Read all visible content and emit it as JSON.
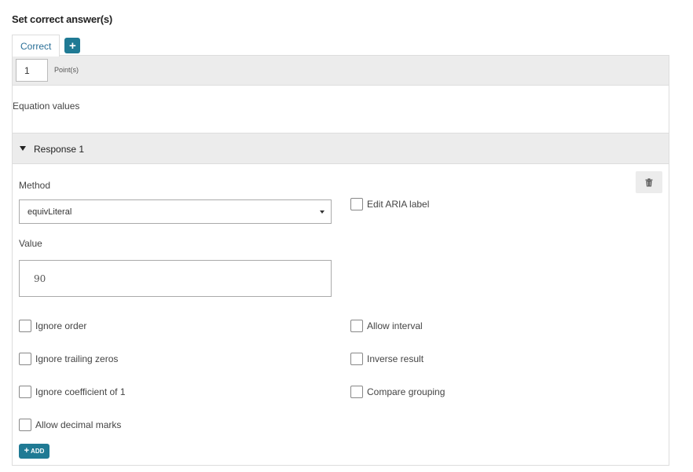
{
  "section_title": "Set correct answer(s)",
  "tabs": [
    {
      "label": "Correct"
    }
  ],
  "tab_add_icon": "plus-icon",
  "points": {
    "value": "1",
    "label": "Point(s)"
  },
  "equation_values_label": "Equation values",
  "response": {
    "title": "Response 1",
    "method_label": "Method",
    "method_value": "equivLiteral",
    "value_label": "Value",
    "value": "90",
    "aria_label": "Edit ARIA label",
    "options_left": [
      "Ignore order",
      "Ignore trailing zeros",
      "Ignore coefficient of 1",
      "Allow decimal marks"
    ],
    "options_right": [
      "Allow interval",
      "Inverse result",
      "Compare grouping"
    ],
    "add_label": "ADD"
  },
  "colors": {
    "accent": "#1f7a94",
    "tab_text": "#2a6f97",
    "header_bg": "#ececec"
  }
}
